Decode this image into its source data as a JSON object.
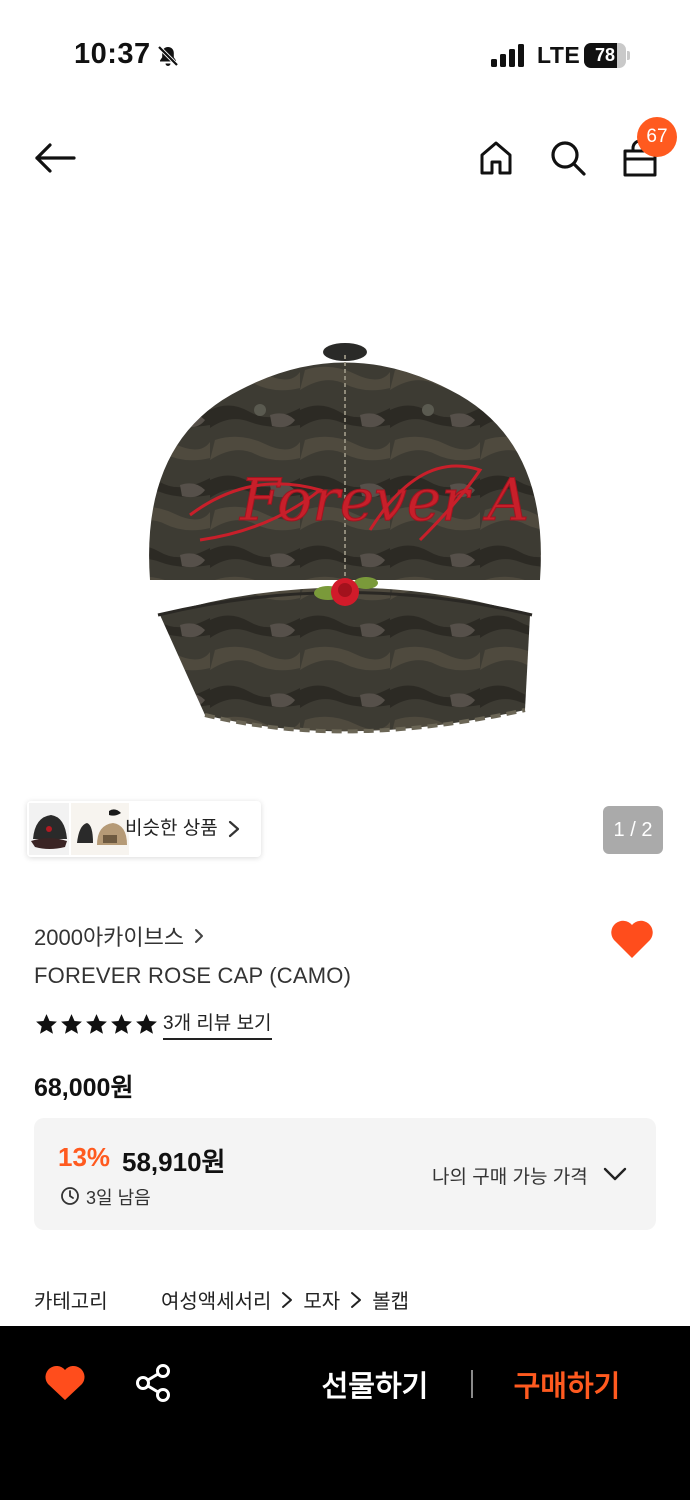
{
  "status_bar": {
    "time": "10:37",
    "network": "LTE",
    "battery": "78",
    "battery_level": 0.78
  },
  "header": {
    "back_icon": "arrow-left-icon",
    "home_icon": "home-icon",
    "search_icon": "search-icon",
    "cart_icon": "shopping-bag-icon",
    "cart_count": "67"
  },
  "gallery": {
    "similar_label": "비슷한 상품",
    "page_indicator": "1 / 2",
    "image_caption": "Forever A"
  },
  "product": {
    "brand": "2000아카이브스",
    "name": "FOREVER ROSE CAP (CAMO)",
    "rating_stars": 5,
    "review_link": "3개 리뷰 보기",
    "original_price": "68,000원"
  },
  "price_box": {
    "discount_rate": "13%",
    "sale_price": "58,910원",
    "time_left": "3일 남음",
    "my_price_label": "나의 구매 가능 가격"
  },
  "category": {
    "label": "카테고리",
    "path": [
      "여성액세서리",
      "모자",
      "볼캡"
    ]
  },
  "bottom_bar": {
    "gift": "선물하기",
    "buy": "구매하기"
  },
  "colors": {
    "accent": "#ff5a1f",
    "bottom_bar_bg": "#000000",
    "price_box_bg": "#f4f4f4"
  }
}
